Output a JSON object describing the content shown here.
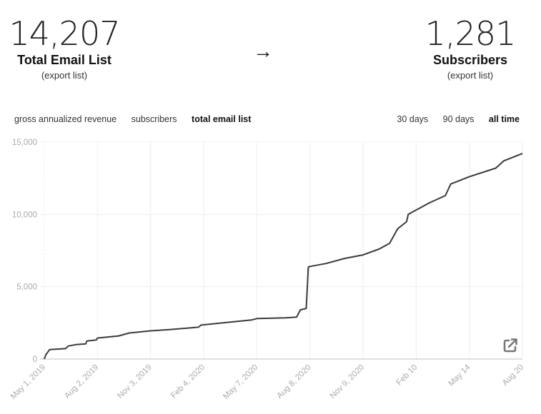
{
  "stats": {
    "left": {
      "value": "14,207",
      "label": "Total Email List",
      "link": "(export list)"
    },
    "arrow": "→",
    "right": {
      "value": "1,281",
      "label": "Subscribers",
      "link": "(export list)"
    }
  },
  "metric_tabs": [
    {
      "label": "gross annualized revenue",
      "active": false
    },
    {
      "label": "subscribers",
      "active": false
    },
    {
      "label": "total email list",
      "active": true
    }
  ],
  "range_tabs": [
    {
      "label": "30 days",
      "active": false
    },
    {
      "label": "90 days",
      "active": false
    },
    {
      "label": "all time",
      "active": true
    }
  ],
  "icons": {
    "external": "external-link-icon"
  },
  "colors": {
    "line": "#3a3a3a",
    "grid": "#eeeeee",
    "axis": "#cccccc",
    "tick_text": "#aaaaaa"
  },
  "chart_data": {
    "type": "line",
    "title": "",
    "xlabel": "",
    "ylabel": "",
    "ylim": [
      0,
      15000
    ],
    "yticks": [
      0,
      5000,
      10000,
      15000
    ],
    "ytick_labels": [
      "0",
      "5,000",
      "10,000",
      "15,000"
    ],
    "xtick_labels": [
      "May 1, 2019",
      "Aug 2, 2019",
      "Nov 3, 2019",
      "Feb 4, 2020",
      "May 7, 2020",
      "Aug 8, 2020",
      "Nov 9, 2020",
      "Feb 10",
      "May 14",
      "Aug 20"
    ],
    "grid": true,
    "legend": "none",
    "series": [
      {
        "name": "total email list",
        "x_tick_index": [
          0,
          0.03,
          0.1,
          0.4,
          0.45,
          0.6,
          0.78,
          0.8,
          0.98,
          1.0,
          1.4,
          1.6,
          2.0,
          2.4,
          2.9,
          2.95,
          3.5,
          3.9,
          4.0,
          4.55,
          4.75,
          4.82,
          4.93,
          4.97,
          5.0,
          5.3,
          5.65,
          6.0,
          6.3,
          6.5,
          6.65,
          6.82,
          6.85,
          7.0,
          7.25,
          7.55,
          7.65,
          8.0,
          8.5,
          8.65,
          9.0
        ],
        "values": [
          0,
          300,
          650,
          720,
          900,
          1000,
          1050,
          1250,
          1320,
          1450,
          1600,
          1800,
          1950,
          2050,
          2200,
          2350,
          2550,
          2700,
          2800,
          2850,
          2900,
          3400,
          3500,
          6350,
          6400,
          6600,
          6950,
          7200,
          7600,
          8000,
          9000,
          9500,
          10000,
          10300,
          10800,
          11300,
          12100,
          12600,
          13200,
          13700,
          14207
        ]
      }
    ]
  }
}
